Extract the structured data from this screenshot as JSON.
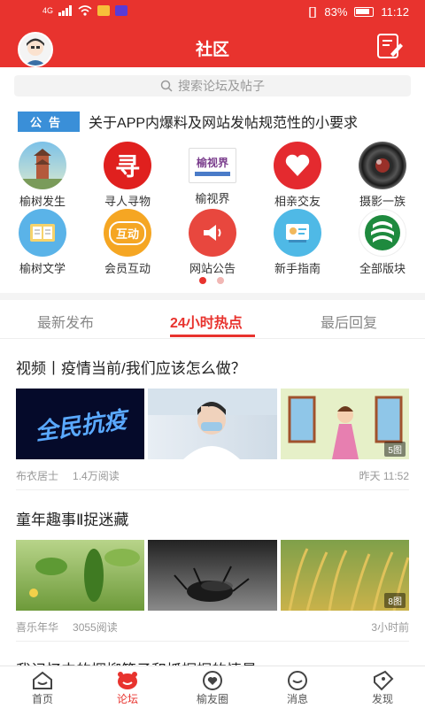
{
  "status_bar": {
    "carrier": "4G",
    "battery_percent": "83%",
    "time": "11:12"
  },
  "header": {
    "title": "社区"
  },
  "search": {
    "placeholder": "搜索论坛及帖子"
  },
  "notice": {
    "tag": "公告",
    "text": "关于APP内爆料及网站发帖规范性的小要求"
  },
  "categories": [
    {
      "label": "榆树发生",
      "icon": "tower-photo-icon"
    },
    {
      "label": "寻人寻物",
      "icon": "search-person-icon",
      "glyph": "寻"
    },
    {
      "label": "榆视界",
      "icon": "yushijie-logo-icon",
      "glyph": "榆视界"
    },
    {
      "label": "相亲交友",
      "icon": "heart-icon"
    },
    {
      "label": "摄影一族",
      "icon": "camera-lens-icon"
    },
    {
      "label": "榆树文学",
      "icon": "book-icon"
    },
    {
      "label": "会员互动",
      "icon": "interaction-icon",
      "glyph": "互动"
    },
    {
      "label": "网站公告",
      "icon": "speaker-icon"
    },
    {
      "label": "新手指南",
      "icon": "guide-icon"
    },
    {
      "label": "全部版块",
      "icon": "all-sections-icon"
    }
  ],
  "pager": {
    "pages": 2,
    "current": 1
  },
  "tabs": [
    {
      "label": "最新发布",
      "active": false
    },
    {
      "label": "24小时热点",
      "active": true
    },
    {
      "label": "最后回复",
      "active": false
    }
  ],
  "posts": [
    {
      "title": "视频丨疫情当前/我们应该怎么做？",
      "image_count": "5图",
      "author": "布衣居士",
      "reads": "1.4万阅读",
      "time": "昨天 11:52",
      "thumb_text": "全民抗疫"
    },
    {
      "title": "童年趣事Ⅱ捉迷藏",
      "image_count": "8图",
      "author": "喜乐年华",
      "reads": "3055阅读",
      "time": "3小时前"
    },
    {
      "title": "我记忆中的捆柳笆子和抓蝈蝈的情景"
    }
  ],
  "bottom_nav": [
    {
      "label": "首页",
      "icon": "home-icon",
      "active": false
    },
    {
      "label": "论坛",
      "icon": "forum-icon",
      "active": true
    },
    {
      "label": "榆友圈",
      "icon": "friends-circle-icon",
      "active": false
    },
    {
      "label": "消息",
      "icon": "message-icon",
      "active": false
    },
    {
      "label": "发现",
      "icon": "discover-icon",
      "active": false
    }
  ],
  "colors": {
    "brand": "#e8332e",
    "notice_tag": "#3a8fd8"
  }
}
